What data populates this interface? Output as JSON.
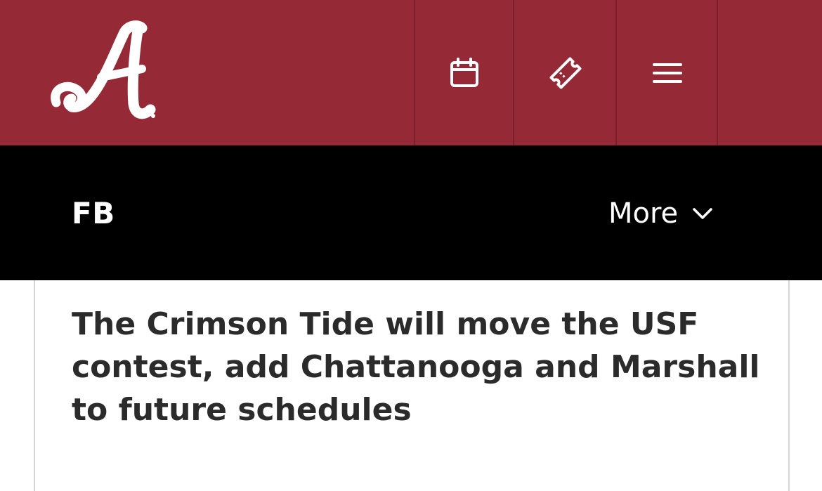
{
  "header": {
    "brand_color": "#952a36",
    "logo_letter": "A",
    "icons": [
      "calendar-icon",
      "ticket-icon",
      "hamburger-menu-icon"
    ]
  },
  "subnav": {
    "sport": "FB",
    "more_label": "More"
  },
  "article": {
    "headline": "The Crimson Tide will move the USF contest, add Chattanooga and Marshall to future schedules"
  }
}
